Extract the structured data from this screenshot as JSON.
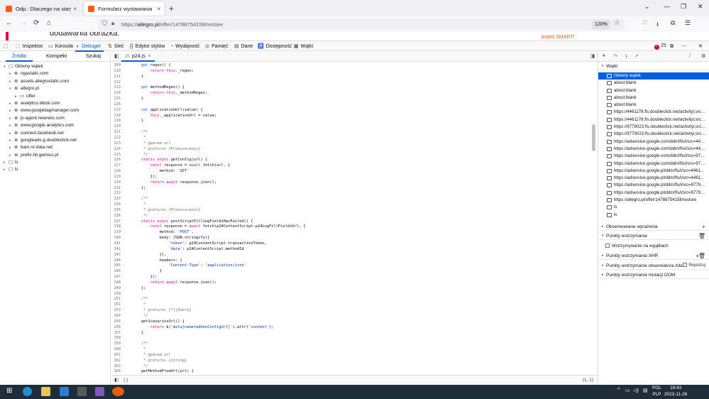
{
  "browser": {
    "tabs": [
      {
        "title": "Odp.: Dlaczego na starym form",
        "close": "×",
        "favicon_color": "#ff5a00"
      },
      {
        "title": "Formularz wystawiania",
        "close": "×",
        "favicon_color": "#ff5a00"
      }
    ],
    "new_tab": "+",
    "window_controls": {
      "minimize": "—",
      "restore": "❐",
      "close": "✕",
      "tab_list": "⌄"
    },
    "nav": {
      "back": "←",
      "forward": "→",
      "reload": "⟳",
      "home": "⌂"
    },
    "url": {
      "prefix": "https://",
      "host": "allegro.pl",
      "path": "/offer/14788754158/restore"
    },
    "zoom": "120%",
    "toolbar_icons": {
      "pocket": "♡",
      "downloads": "⭳",
      "extensions": "⧉",
      "menu": "☰"
    }
  },
  "webpage": {
    "visible_text": "dodawania obrazka.",
    "brand_text": "jesteś SMART!"
  },
  "devtools": {
    "tools": [
      {
        "label": "Inspektor",
        "icon": "⬚"
      },
      {
        "label": "Konsola",
        "icon": "▭"
      },
      {
        "label": "Debuger",
        "icon": "◐"
      },
      {
        "label": "Sieć",
        "icon": "⇅"
      },
      {
        "label": "Edytor stylów",
        "icon": "{}"
      },
      {
        "label": "Wydajność",
        "icon": "◔"
      },
      {
        "label": "Pamięć",
        "icon": "◎"
      },
      {
        "label": "Dane",
        "icon": "▤"
      },
      {
        "label": "Dostępność",
        "icon": "♿"
      },
      {
        "label": "Wątki",
        "icon": "▦"
      }
    ],
    "error_count": "25",
    "left_tabs": [
      "Źródła",
      "Konspekt",
      "Szukaj"
    ],
    "source_tree": [
      {
        "label": "Główny wątek",
        "depth": 0,
        "icon": "window-icon",
        "twisty": "▾"
      },
      {
        "label": "ngastatic.com",
        "depth": 1,
        "icon": "globe-icon",
        "twisty": "▸"
      },
      {
        "label": "assets.allegrostatic.com",
        "depth": 1,
        "icon": "globe-icon",
        "twisty": "▸"
      },
      {
        "label": "allegro.pl",
        "depth": 1,
        "icon": "globe-icon",
        "twisty": "▾"
      },
      {
        "label": "offer",
        "depth": 2,
        "icon": "folder-icon",
        "twisty": "▸"
      },
      {
        "label": "analytics.tiktok.com",
        "depth": 1,
        "icon": "globe-icon",
        "twisty": "▸"
      },
      {
        "label": "www.googletagmanager.com",
        "depth": 1,
        "icon": "globe-icon",
        "twisty": "▸"
      },
      {
        "label": "js-agent.newrelic.com",
        "depth": 1,
        "icon": "globe-icon",
        "twisty": "▸"
      },
      {
        "label": "www.google-analytics.com",
        "depth": 1,
        "icon": "globe-icon",
        "twisty": "▸"
      },
      {
        "label": "connect.facebook.net",
        "depth": 1,
        "icon": "globe-icon",
        "twisty": "▸"
      },
      {
        "label": "googleads.g.doubleclick.net",
        "depth": 1,
        "icon": "globe-icon",
        "twisty": "▸"
      },
      {
        "label": "bam.nr-data.net",
        "depth": 1,
        "icon": "globe-icon",
        "twisty": "▸"
      },
      {
        "label": "prefix.hit.gemius.pl",
        "depth": 1,
        "icon": "globe-icon",
        "twisty": "▸"
      },
      {
        "label": "ls",
        "depth": 0,
        "icon": "window-icon",
        "twisty": "▸"
      },
      {
        "label": "ls",
        "depth": 0,
        "icon": "window-icon",
        "twisty": "▸"
      }
    ],
    "editor_tab": {
      "label": "p24.js",
      "badge": "JS",
      "close": "×"
    },
    "code_lines": [
      {
        "n": "109",
        "h": "    <span class=\"fn\">get</span> regex() {"
      },
      {
        "n": "110",
        "h": "        <span class=\"kw\">return this</span>._regex;"
      },
      {
        "n": "111",
        "h": "    }"
      },
      {
        "n": "112",
        "h": ""
      },
      {
        "n": "113",
        "h": "    <span class=\"fn\">get</span> methodRegex() {"
      },
      {
        "n": "114",
        "h": "        <span class=\"kw\">return this</span>._methodRegex;"
      },
      {
        "n": "115",
        "h": "    }"
      },
      {
        "n": "116",
        "h": ""
      },
      {
        "n": "117",
        "h": "    <span class=\"fn\">set</span> applicationUrl(value) {"
      },
      {
        "n": "118",
        "h": "        <span class=\"kw\">this</span>._applicationUrl = value;"
      },
      {
        "n": "119",
        "h": "    }"
      },
      {
        "n": "120",
        "h": ""
      },
      {
        "n": "121",
        "h": "    <span class=\"cm\">/**</span>"
      },
      {
        "n": "122",
        "h": "<span class=\"cm\">     *</span>"
      },
      {
        "n": "123",
        "h": "<span class=\"cm\">     * @param url</span>"
      },
      {
        "n": "124",
        "h": "<span class=\"cm\">     * @returns {Promise&lt;any&gt;}</span>"
      },
      {
        "n": "125",
        "h": "<span class=\"cm\">     */</span>"
      },
      {
        "n": "126",
        "h": "    <span class=\"kw\">static async</span> getConfig(url) {"
      },
      {
        "n": "127",
        "h": "        <span class=\"kw\">const</span> response = <span class=\"kw\">await</span> fetch(url, {"
      },
      {
        "n": "128",
        "h": "            method: <span class=\"str\">'GET'</span>"
      },
      {
        "n": "129",
        "h": "        });"
      },
      {
        "n": "130",
        "h": "        <span class=\"kw\">return await</span> response.json();"
      },
      {
        "n": "131",
        "h": "    };"
      },
      {
        "n": "132",
        "h": ""
      },
      {
        "n": "133",
        "h": "    <span class=\"cm\">/**</span>"
      },
      {
        "n": "134",
        "h": "<span class=\"cm\">     *</span>"
      },
      {
        "n": "135",
        "h": "<span class=\"cm\">     * @returns {Promise&lt;any&gt;}</span>"
      },
      {
        "n": "136",
        "h": "<span class=\"cm\">     */</span>"
      },
      {
        "n": "137",
        "h": "    <span class=\"kw\">static async</span> postScriptFillingFieldsHasFailed() {"
      },
      {
        "n": "138",
        "h": "        <span class=\"kw\">const</span> response = <span class=\"kw\">await</span> fetch(p24ContentScript.p24LogFillFieldsUrl, {"
      },
      {
        "n": "139",
        "h": "            method: <span class=\"str\">'POST'</span>,"
      },
      {
        "n": "140",
        "h": "            body: JSON.stringify({"
      },
      {
        "n": "141",
        "h": "                <span class=\"str\">'token'</span>: p24ContentScript.transactionToken,"
      },
      {
        "n": "142",
        "h": "                <span class=\"str\">'data'</span>: p24ContentScript.methodId"
      },
      {
        "n": "143",
        "h": "            }),"
      },
      {
        "n": "144",
        "h": "            headers: {"
      },
      {
        "n": "145",
        "h": "                <span class=\"str\">'Content-Type'</span>: <span class=\"str\">'application/json'</span>"
      },
      {
        "n": "146",
        "h": "            }"
      },
      {
        "n": "147",
        "h": "        });"
      },
      {
        "n": "148",
        "h": "        <span class=\"kw\">return await</span> response.json();"
      },
      {
        "n": "149",
        "h": "    };"
      },
      {
        "n": "150",
        "h": ""
      },
      {
        "n": "151",
        "h": "    <span class=\"cm\">/**</span>"
      },
      {
        "n": "152",
        "h": "<span class=\"cm\">     *</span>"
      },
      {
        "n": "153",
        "h": "<span class=\"cm\">     * @returns {*|jQuery}</span>"
      },
      {
        "n": "154",
        "h": "<span class=\"cm\">     */</span>"
      },
      {
        "n": "155",
        "h": "    getScenariosUrl() {"
      },
      {
        "n": "156",
        "h": "        <span class=\"kw\">return</span> $(<span class=\"str\">'meta[name=addonConfigUrl]'</span>).attr(<span class=\"str\">'content'</span>);"
      },
      {
        "n": "157",
        "h": "    }"
      },
      {
        "n": "158",
        "h": ""
      },
      {
        "n": "159",
        "h": "    <span class=\"cm\">/**</span>"
      },
      {
        "n": "160",
        "h": "<span class=\"cm\">     *</span>"
      },
      {
        "n": "161",
        "h": "<span class=\"cm\">     * @param url</span>"
      },
      {
        "n": "162",
        "h": "<span class=\"cm\">     * @returns {string}</span>"
      },
      {
        "n": "163",
        "h": "<span class=\"cm\">     */</span>"
      },
      {
        "n": "164",
        "h": "    getMethodFromUrl(url) {"
      }
    ],
    "footer": {
      "braces": "{ }",
      "cursor_position": "(1, 1)"
    },
    "right": {
      "threads_header": "Wątki",
      "threads": [
        "Główny wątek",
        "about:blank",
        "about:blank",
        "about:blank",
        "about:blank",
        "https://4461178.fls.doubleclick.net/activityi;src=...",
        "https://4461178.fls.doubleclick.net/activityi;src=...",
        "https://9779023.fls.doubleclick.net/activityi;src=...",
        "https://9779023.fls.doubleclick.net/activityi;src=...",
        "https://adservice.google.com/ddm/fls/i/src=446...",
        "https://adservice.google.com/ddm/fls/i/src=446...",
        "https://adservice.google.com/ddm/fls/i/src=977...",
        "https://adservice.google.com/ddm/fls/i/src=977...",
        "https://adservice.google.pl/ddm/fls/i/src=44611...",
        "https://adservice.google.pl/ddm/fls/i/src=44611...",
        "https://adservice.google.pl/ddm/fls/i/src=97790...",
        "https://adservice.google.pl/ddm/fls/i/src=97790...",
        "https://allegro.pl/offer/14788754158/restore",
        "ls",
        "ls"
      ],
      "watch_header": "Obserwowane wyrażenia",
      "breakpoints_header": "Punkty wstrzymania",
      "pause_on_exceptions": "Wstrzymywanie na wyjątkach",
      "xhr_header": "Punkty wstrzymania XHR",
      "event_header": "Punkty wstrzymania obserwatora zdar...",
      "event_checkbox": "Rejestruj",
      "dom_header": "Punkty wstrzymania mutacji DOM"
    }
  },
  "taskbar": {
    "start": "⊞",
    "tray": {
      "chevron": "^",
      "lang_top": "POL",
      "lang_bottom": "PLP",
      "time": "19:43",
      "date": "2023-11-28"
    }
  }
}
